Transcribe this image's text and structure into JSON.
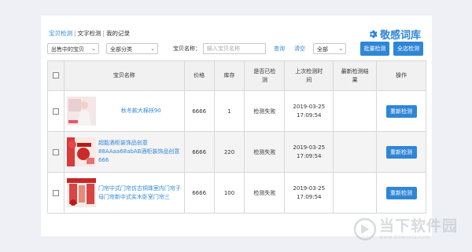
{
  "tabs": [
    "宝贝检测",
    "文字检测",
    "我的记录"
  ],
  "brand": {
    "name": "敬感词库"
  },
  "filters": {
    "status_select": "出售中的宝贝",
    "category_select": "全部分类",
    "name_label": "宝贝名称：",
    "name_placeholder": "输入宝贝名称",
    "search_link": "查询",
    "clear_link": "清空",
    "result_select": "全部",
    "batch_button": "批量检测",
    "all_button": "全店检测"
  },
  "table": {
    "headers": [
      "宝贝名称",
      "价格",
      "库存",
      "是否已检测",
      "上次检测时间",
      "最新检测结果",
      "操作"
    ],
    "rows": [
      {
        "name": "秋冬款大棉袄90",
        "price": "6666",
        "stock": "1",
        "status": "检测失败",
        "date": "2019-03-25",
        "time": "17:09:54",
        "result": "",
        "action": "重新检测"
      },
      {
        "name": "超能酒柜装饰品创意88AAaa68abAB酒柜装饰品创意666",
        "price": "6666",
        "stock": "220",
        "status": "检测失败",
        "date": "2019-03-25",
        "time": "17:09:54",
        "result": "",
        "action": "重新检测"
      },
      {
        "name": "门帘中式门帘仿古铜珠室内门帘子母门帘新中式实木卧室门帘三",
        "price": "6666",
        "stock": "100",
        "status": "检测失败",
        "date": "2019-03-25",
        "time": "17:09:54",
        "result": "",
        "action": "重新检测"
      }
    ]
  },
  "watermark": {
    "cn": "当下软件园",
    "url": "www.downxia.com"
  }
}
